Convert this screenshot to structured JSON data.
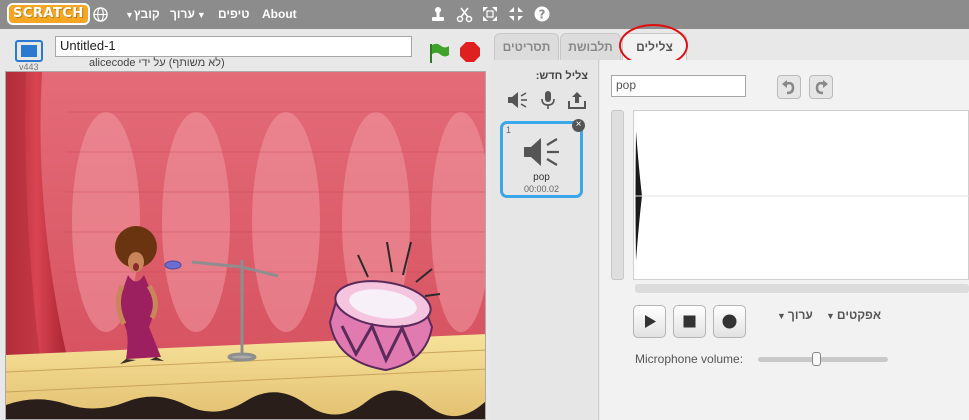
{
  "topbar": {
    "logo": "SCRATCH",
    "menus": {
      "file": "קובץ",
      "edit": "ערוך",
      "tips": "טיפים",
      "about": "About"
    }
  },
  "stage": {
    "project_title": "Untitled-1",
    "byline": "(לא משותף) על ידי alicecode",
    "version": "v443"
  },
  "tabs": {
    "scripts": "תסריטים",
    "costumes": "תלבושת",
    "sounds": "צלילים",
    "active": "sounds"
  },
  "sounds_pane": {
    "new_sound_label": "צליל חדש:",
    "items": [
      {
        "index": "1",
        "name": "pop",
        "duration": "00:00.02"
      }
    ]
  },
  "editor": {
    "sound_name": "pop",
    "edit_menu": "ערוך",
    "effects_menu": "אפקטים",
    "mic_volume_label": "Microphone volume:",
    "mic_volume_level": 0.45
  }
}
